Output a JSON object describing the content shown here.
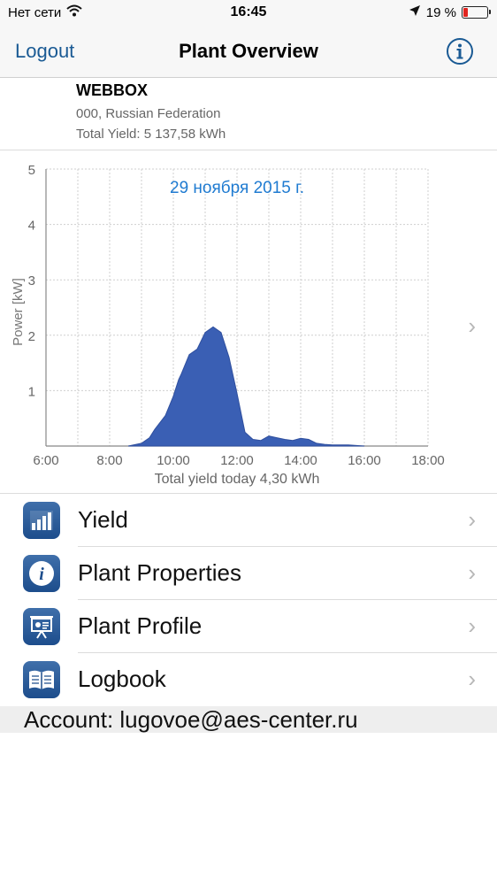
{
  "status_bar": {
    "carrier": "Нет сети",
    "time": "16:45",
    "battery_percent": "19 %",
    "battery_level": 0.19,
    "icons": [
      "wifi-icon",
      "location-arrow-icon",
      "battery-icon"
    ]
  },
  "nav": {
    "left_button": "Logout",
    "title": "Plant Overview",
    "right_button_icon": "info-icon"
  },
  "plant": {
    "name": "WEBBOX",
    "location": "000, Russian Federation",
    "total_yield": "Total Yield: 5 137,58 kWh"
  },
  "chart": {
    "footer": "Total yield today 4,30 kWh"
  },
  "chart_data": {
    "type": "area",
    "title": "29 ноября 2015 г.",
    "ylabel": "Power [kW]",
    "xlabel": "",
    "ylim": [
      0,
      5
    ],
    "xlim": [
      6,
      18
    ],
    "y_ticks": [
      "1",
      "2",
      "3",
      "4",
      "5"
    ],
    "x_tick_labels": [
      "6:00",
      "8:00",
      "10:00",
      "12:00",
      "14:00",
      "16:00",
      "18:00"
    ],
    "grid": true,
    "color": "#3a5fb4",
    "series": [
      {
        "x": [
          "8:35",
          "9:00",
          "9:15",
          "9:25",
          "9:45",
          "10:00",
          "10:10",
          "10:15",
          "10:30",
          "10:45",
          "11:00",
          "11:15",
          "11:30",
          "11:45",
          "12:00",
          "12:15",
          "12:30",
          "12:45",
          "13:00",
          "13:15",
          "13:30",
          "13:45",
          "14:00",
          "14:15",
          "14:30",
          "14:45",
          "15:00",
          "15:30",
          "16:00"
        ],
        "y": [
          0,
          0.05,
          0.15,
          0.3,
          0.55,
          0.9,
          1.2,
          1.3,
          1.65,
          1.75,
          2.05,
          2.15,
          2.05,
          1.6,
          0.95,
          0.25,
          0.12,
          0.1,
          0.18,
          0.15,
          0.12,
          0.1,
          0.14,
          0.12,
          0.05,
          0.03,
          0.02,
          0.02,
          0
        ]
      }
    ]
  },
  "menu": {
    "items": [
      {
        "label": "Yield",
        "icon": "bar-chart-icon"
      },
      {
        "label": "Plant Properties",
        "icon": "info-icon"
      },
      {
        "label": "Plant Profile",
        "icon": "presentation-icon"
      },
      {
        "label": "Logbook",
        "icon": "book-icon"
      }
    ]
  },
  "account": {
    "text": "Account: lugovoe@aes-center.ru"
  }
}
